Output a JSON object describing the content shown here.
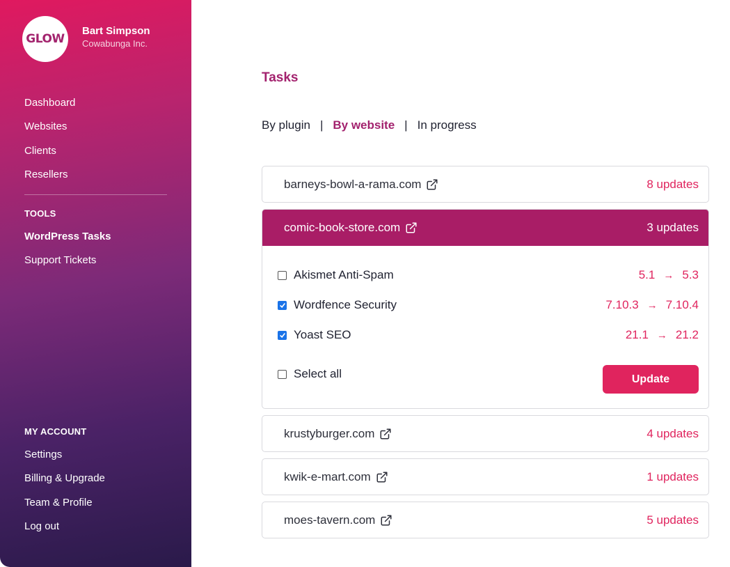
{
  "profile": {
    "logo_text": "GLOW",
    "name": "Bart Simpson",
    "company": "Cowabunga Inc."
  },
  "sidebar": {
    "main_items": [
      {
        "label": "Dashboard"
      },
      {
        "label": "Websites"
      },
      {
        "label": "Clients"
      },
      {
        "label": "Resellers"
      }
    ],
    "tools_heading": "TOOLS",
    "tools_items": [
      {
        "label": "WordPress Tasks",
        "active": true
      },
      {
        "label": "Support Tickets"
      }
    ],
    "account_heading": "MY ACCOUNT",
    "account_items": [
      {
        "label": "Settings"
      },
      {
        "label": "Billing & Upgrade"
      },
      {
        "label": "Team & Profile"
      },
      {
        "label": "Log out"
      }
    ]
  },
  "main": {
    "title": "Tasks",
    "tabs": [
      {
        "label": "By plugin"
      },
      {
        "label": "By website",
        "active": true
      },
      {
        "label": "In progress"
      }
    ],
    "tab_separator": "|",
    "sites": [
      {
        "name": "barneys-bowl-a-rama.com",
        "updates": "8 updates"
      },
      {
        "name": "comic-book-store.com",
        "updates": "3 updates",
        "expanded": true
      },
      {
        "name": "krustyburger.com",
        "updates": "4 updates"
      },
      {
        "name": "kwik-e-mart.com",
        "updates": "1 updates"
      },
      {
        "name": "moes-tavern.com",
        "updates": "5 updates"
      }
    ],
    "plugins": [
      {
        "name": "Akismet Anti-Spam",
        "from": "5.1",
        "to": "5.3",
        "checked": false
      },
      {
        "name": "Wordfence Security",
        "from": "7.10.3",
        "to": "7.10.4",
        "checked": true
      },
      {
        "name": "Yoast SEO",
        "from": "21.1",
        "to": "21.2",
        "checked": true
      }
    ],
    "select_all_label": "Select all",
    "select_all_checked": false,
    "update_button": "Update",
    "arrow_glyph": "→"
  },
  "colors": {
    "brand": "#a91d66",
    "accent": "#e0245e",
    "checkbox_checked": "#1a73e8"
  },
  "icons": {
    "external_link": "external-link-icon",
    "checkmark": "checkmark-icon"
  }
}
